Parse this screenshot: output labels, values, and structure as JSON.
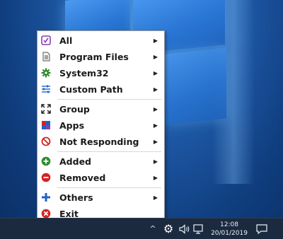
{
  "menu": {
    "groups": [
      [
        {
          "label": "All",
          "icon": "checkbox-icon",
          "submenu": true
        },
        {
          "label": "Program Files",
          "icon": "document-icon",
          "submenu": true
        },
        {
          "label": "System32",
          "icon": "gear-icon",
          "submenu": true
        },
        {
          "label": "Custom Path",
          "icon": "sliders-icon",
          "submenu": true
        }
      ],
      [
        {
          "label": "Group",
          "icon": "expand-icon",
          "submenu": true
        },
        {
          "label": "Apps",
          "icon": "apps-icon",
          "submenu": true
        },
        {
          "label": "Not Responding",
          "icon": "no-entry-icon",
          "submenu": true
        }
      ],
      [
        {
          "label": "Added",
          "icon": "plus-circle-icon",
          "submenu": true
        },
        {
          "label": "Removed",
          "icon": "minus-circle-icon",
          "submenu": true
        }
      ],
      [
        {
          "label": "Others",
          "icon": "plus-icon",
          "submenu": true
        },
        {
          "label": "Exit",
          "icon": "close-circle-icon",
          "submenu": false
        }
      ]
    ],
    "submenu_arrow": "▶"
  },
  "taskbar": {
    "chevron": "^",
    "gear": "⚙",
    "clock_time": "12:08",
    "clock_date": "20/01/2019"
  },
  "colors": {
    "accent_purple": "#8a3fb0",
    "green": "#2e8b2e",
    "blue": "#1f63c9",
    "red": "#d42323"
  }
}
